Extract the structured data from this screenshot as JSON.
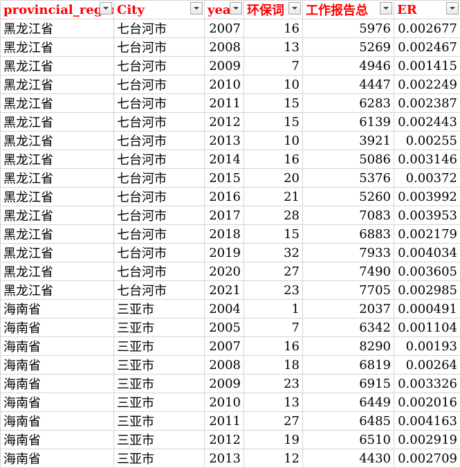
{
  "headers": {
    "region": "provincial_region",
    "city": "City",
    "year": "year",
    "env": "环保词",
    "report": "工作报告总",
    "er": "ER"
  },
  "icons": {
    "filter": "filter-dropdown-icon"
  },
  "colors": {
    "header_text": "#ff0000",
    "gridline": "#d4d4d4"
  },
  "rows": [
    {
      "region": "黑龙江省",
      "city": "七台河市",
      "year": "2007",
      "env": "16",
      "report": "5976",
      "er": "0.002677"
    },
    {
      "region": "黑龙江省",
      "city": "七台河市",
      "year": "2008",
      "env": "13",
      "report": "5269",
      "er": "0.002467"
    },
    {
      "region": "黑龙江省",
      "city": "七台河市",
      "year": "2009",
      "env": "7",
      "report": "4946",
      "er": "0.001415"
    },
    {
      "region": "黑龙江省",
      "city": "七台河市",
      "year": "2010",
      "env": "10",
      "report": "4447",
      "er": "0.002249"
    },
    {
      "region": "黑龙江省",
      "city": "七台河市",
      "year": "2011",
      "env": "15",
      "report": "6283",
      "er": "0.002387"
    },
    {
      "region": "黑龙江省",
      "city": "七台河市",
      "year": "2012",
      "env": "15",
      "report": "6139",
      "er": "0.002443"
    },
    {
      "region": "黑龙江省",
      "city": "七台河市",
      "year": "2013",
      "env": "10",
      "report": "3921",
      "er": "0.00255"
    },
    {
      "region": "黑龙江省",
      "city": "七台河市",
      "year": "2014",
      "env": "16",
      "report": "5086",
      "er": "0.003146"
    },
    {
      "region": "黑龙江省",
      "city": "七台河市",
      "year": "2015",
      "env": "20",
      "report": "5376",
      "er": "0.00372"
    },
    {
      "region": "黑龙江省",
      "city": "七台河市",
      "year": "2016",
      "env": "21",
      "report": "5260",
      "er": "0.003992"
    },
    {
      "region": "黑龙江省",
      "city": "七台河市",
      "year": "2017",
      "env": "28",
      "report": "7083",
      "er": "0.003953"
    },
    {
      "region": "黑龙江省",
      "city": "七台河市",
      "year": "2018",
      "env": "15",
      "report": "6883",
      "er": "0.002179"
    },
    {
      "region": "黑龙江省",
      "city": "七台河市",
      "year": "2019",
      "env": "32",
      "report": "7933",
      "er": "0.004034"
    },
    {
      "region": "黑龙江省",
      "city": "七台河市",
      "year": "2020",
      "env": "27",
      "report": "7490",
      "er": "0.003605"
    },
    {
      "region": "黑龙江省",
      "city": "七台河市",
      "year": "2021",
      "env": "23",
      "report": "7705",
      "er": "0.002985"
    },
    {
      "region": "海南省",
      "city": "三亚市",
      "year": "2004",
      "env": "1",
      "report": "2037",
      "er": "0.000491"
    },
    {
      "region": "海南省",
      "city": "三亚市",
      "year": "2005",
      "env": "7",
      "report": "6342",
      "er": "0.001104"
    },
    {
      "region": "海南省",
      "city": "三亚市",
      "year": "2007",
      "env": "16",
      "report": "8290",
      "er": "0.00193"
    },
    {
      "region": "海南省",
      "city": "三亚市",
      "year": "2008",
      "env": "18",
      "report": "6819",
      "er": "0.00264"
    },
    {
      "region": "海南省",
      "city": "三亚市",
      "year": "2009",
      "env": "23",
      "report": "6915",
      "er": "0.003326"
    },
    {
      "region": "海南省",
      "city": "三亚市",
      "year": "2010",
      "env": "13",
      "report": "6449",
      "er": "0.002016"
    },
    {
      "region": "海南省",
      "city": "三亚市",
      "year": "2011",
      "env": "27",
      "report": "6485",
      "er": "0.004163"
    },
    {
      "region": "海南省",
      "city": "三亚市",
      "year": "2012",
      "env": "19",
      "report": "6510",
      "er": "0.002919"
    },
    {
      "region": "海南省",
      "city": "三亚市",
      "year": "2013",
      "env": "12",
      "report": "4430",
      "er": "0.002709"
    }
  ]
}
